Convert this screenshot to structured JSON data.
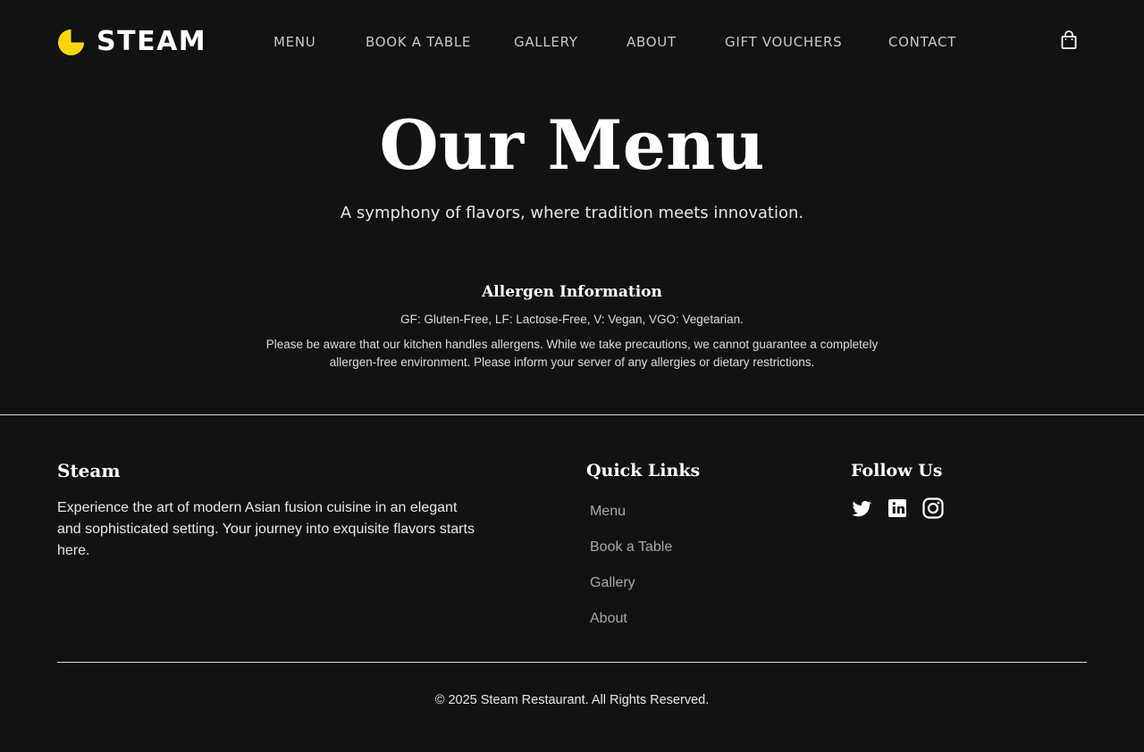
{
  "brand": {
    "name": "STEAM",
    "accent_color": "#FFD60A"
  },
  "nav": {
    "items": [
      {
        "label": "MENU"
      },
      {
        "label": "BOOK A TABLE"
      },
      {
        "label": "GALLERY"
      },
      {
        "label": "ABOUT"
      },
      {
        "label": "GIFT VOUCHERS"
      },
      {
        "label": "CONTACT"
      }
    ],
    "cart_icon": "shopping-bag-icon"
  },
  "hero": {
    "title": "Our Menu",
    "subtitle": "A symphony of flavors, where tradition meets innovation."
  },
  "allergen": {
    "title": "Allergen Information",
    "key": "GF: Gluten-Free, LF: Lactose-Free, V: Vegan, VGO: Vegetarian.",
    "note": "Please be aware that our kitchen handles allergens. While we take precautions, we cannot guarantee a completely allergen-free environment. Please inform your server of any allergies or dietary restrictions."
  },
  "footer": {
    "brand_title": "Steam",
    "brand_description": "Experience the art of modern Asian fusion cuisine in an elegant and sophisticated setting. Your journey into exquisite flavors starts here.",
    "links_title": "Quick Links",
    "links": [
      {
        "label": "Menu"
      },
      {
        "label": "Book a Table"
      },
      {
        "label": "Gallery"
      },
      {
        "label": "About"
      }
    ],
    "follow_title": "Follow Us",
    "social_icons": [
      "twitter-icon",
      "info-icon",
      "instagram-icon"
    ],
    "copyright": "© 2025 Steam Restaurant. All Rights Reserved."
  },
  "colors": {
    "background": "#121212",
    "text": "#FFFFFF",
    "muted_link": "#A8A8A8"
  }
}
